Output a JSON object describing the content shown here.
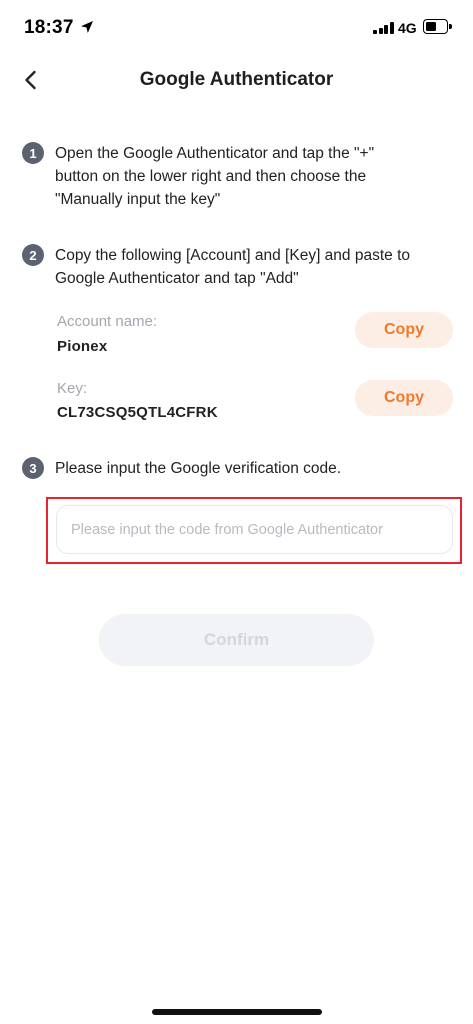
{
  "status_bar": {
    "time": "18:37",
    "network": "4G",
    "icons": [
      "location-arrow-icon",
      "signal-bars-icon",
      "battery-icon"
    ]
  },
  "header": {
    "title": "Google Authenticator",
    "back_icon": "chevron-left-icon"
  },
  "steps": [
    {
      "number": "1",
      "lines": [
        "Open the Google Authenticator and tap the \"+\"",
        "button on the lower right and then choose the",
        "\"Manually input the key\""
      ]
    },
    {
      "number": "2",
      "lines": [
        "Copy the following [Account] and [Key] and paste to",
        "Google Authenticator and tap \"Add\""
      ],
      "account": {
        "label": "Account name:",
        "value": "Pionex",
        "copy_label": "Copy"
      },
      "key": {
        "label": "Key:",
        "value": "CL73CSQ5QTL4CFRK",
        "copy_label": "Copy"
      }
    },
    {
      "number": "3",
      "lines": [
        "Please input the Google verification code."
      ],
      "input": {
        "value": "",
        "placeholder": "Please input the code from Google Authenticator"
      }
    }
  ],
  "confirm_label": "Confirm",
  "colors": {
    "accent": "#f07a2a",
    "copy_bg": "#fdeee5",
    "step_badge": "#5d6270",
    "highlight": "#e8232f",
    "disabled_bg": "#f2f3f6",
    "disabled_text": "#d3d6dc"
  }
}
